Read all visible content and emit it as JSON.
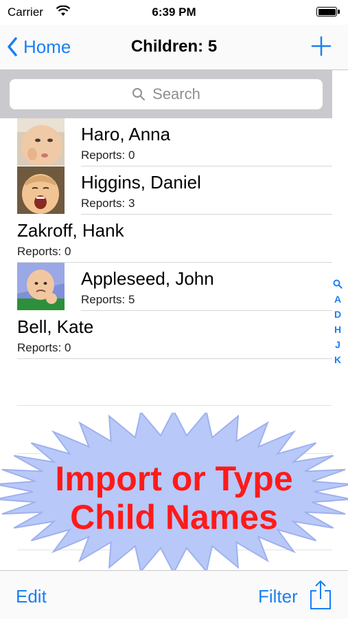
{
  "status_bar": {
    "carrier": "Carrier",
    "time": "6:39 PM"
  },
  "nav": {
    "back_label": "Home",
    "title": "Children: 5"
  },
  "search": {
    "placeholder": "Search"
  },
  "children": [
    {
      "name": "Haro, Anna",
      "reports": "Reports: 0",
      "photo": "baby-photo-finger-mouth"
    },
    {
      "name": "Higgins, Daniel",
      "reports": "Reports: 3",
      "photo": "baby-photo-crying"
    },
    {
      "name": "Zakroff, Hank",
      "reports": "Reports: 0",
      "photo": null
    },
    {
      "name": "Appleseed, John",
      "reports": "Reports: 5",
      "photo": "baby-photo-fist"
    },
    {
      "name": "Bell, Kate",
      "reports": "Reports: 0",
      "photo": null
    }
  ],
  "section_index": [
    "search",
    "A",
    "D",
    "H",
    "J",
    "K"
  ],
  "promo": {
    "line1": "Import or Type",
    "line2": "Child Names"
  },
  "toolbar": {
    "edit_label": "Edit",
    "filter_label": "Filter"
  },
  "colors": {
    "accent": "#1a7ff5",
    "promo_text": "#ff1a1a",
    "promo_burst": "#b8c8f8"
  }
}
